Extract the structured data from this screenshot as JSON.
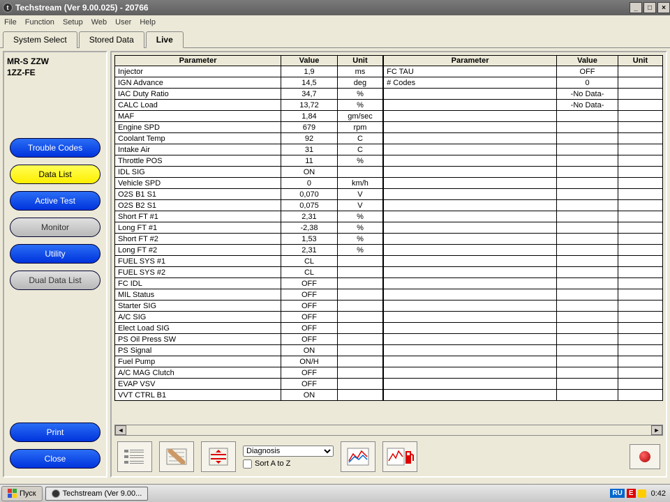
{
  "window": {
    "title": "Techstream (Ver 9.00.025) - 20766"
  },
  "menu": [
    "File",
    "Function",
    "Setup",
    "Web",
    "User",
    "Help"
  ],
  "tabs": {
    "system_select": "System Select",
    "stored_data": "Stored Data",
    "live": "Live"
  },
  "vehicle": {
    "model": "MR-S ZZW",
    "engine": "1ZZ-FE"
  },
  "side_buttons": {
    "trouble_codes": "Trouble Codes",
    "data_list": "Data List",
    "active_test": "Active Test",
    "monitor": "Monitor",
    "utility": "Utility",
    "dual_data_list": "Dual Data List",
    "print": "Print",
    "close": "Close"
  },
  "headers": {
    "parameter": "Parameter",
    "value": "Value",
    "unit": "Unit"
  },
  "left_rows": [
    {
      "p": "Injector",
      "v": "1,9",
      "u": "ms"
    },
    {
      "p": "IGN Advance",
      "v": "14,5",
      "u": "deg"
    },
    {
      "p": "IAC Duty Ratio",
      "v": "34,7",
      "u": "%"
    },
    {
      "p": "CALC Load",
      "v": "13,72",
      "u": "%"
    },
    {
      "p": "MAF",
      "v": "1,84",
      "u": "gm/sec"
    },
    {
      "p": "Engine SPD",
      "v": "679",
      "u": "rpm"
    },
    {
      "p": "Coolant Temp",
      "v": "92",
      "u": "C"
    },
    {
      "p": "Intake Air",
      "v": "31",
      "u": "C"
    },
    {
      "p": "Throttle POS",
      "v": "11",
      "u": "%"
    },
    {
      "p": "IDL SIG",
      "v": "ON",
      "u": ""
    },
    {
      "p": "Vehicle SPD",
      "v": "0",
      "u": "km/h"
    },
    {
      "p": "O2S B1 S1",
      "v": "0,070",
      "u": "V"
    },
    {
      "p": "O2S B2 S1",
      "v": "0,075",
      "u": "V"
    },
    {
      "p": "Short FT #1",
      "v": "2,31",
      "u": "%"
    },
    {
      "p": "Long FT #1",
      "v": "-2,38",
      "u": "%"
    },
    {
      "p": "Short FT #2",
      "v": "1,53",
      "u": "%"
    },
    {
      "p": "Long FT #2",
      "v": "2,31",
      "u": "%"
    },
    {
      "p": "FUEL SYS #1",
      "v": "CL",
      "u": ""
    },
    {
      "p": "FUEL SYS #2",
      "v": "CL",
      "u": ""
    },
    {
      "p": "FC IDL",
      "v": "OFF",
      "u": ""
    },
    {
      "p": "MIL Status",
      "v": "OFF",
      "u": ""
    },
    {
      "p": "Starter SIG",
      "v": "OFF",
      "u": ""
    },
    {
      "p": "A/C SIG",
      "v": "OFF",
      "u": ""
    },
    {
      "p": "Elect Load SIG",
      "v": "OFF",
      "u": ""
    },
    {
      "p": "PS Oil Press SW",
      "v": "OFF",
      "u": ""
    },
    {
      "p": "PS Signal",
      "v": "ON",
      "u": ""
    },
    {
      "p": "Fuel Pump",
      "v": "ON/H",
      "u": ""
    },
    {
      "p": "A/C MAG Clutch",
      "v": "OFF",
      "u": ""
    },
    {
      "p": "EVAP VSV",
      "v": "OFF",
      "u": ""
    },
    {
      "p": "VVT CTRL B1",
      "v": "ON",
      "u": ""
    }
  ],
  "right_rows": [
    {
      "p": "FC TAU",
      "v": "OFF",
      "u": ""
    },
    {
      "p": "# Codes",
      "v": "0",
      "u": ""
    },
    {
      "p": "",
      "v": "-No Data-",
      "u": ""
    },
    {
      "p": "",
      "v": "-No Data-",
      "u": ""
    },
    {
      "p": "",
      "v": "",
      "u": ""
    },
    {
      "p": "",
      "v": "",
      "u": ""
    },
    {
      "p": "",
      "v": "",
      "u": ""
    },
    {
      "p": "",
      "v": "",
      "u": ""
    },
    {
      "p": "",
      "v": "",
      "u": ""
    },
    {
      "p": "",
      "v": "",
      "u": ""
    },
    {
      "p": "",
      "v": "",
      "u": ""
    },
    {
      "p": "",
      "v": "",
      "u": ""
    },
    {
      "p": "",
      "v": "",
      "u": ""
    },
    {
      "p": "",
      "v": "",
      "u": ""
    },
    {
      "p": "",
      "v": "",
      "u": ""
    },
    {
      "p": "",
      "v": "",
      "u": ""
    },
    {
      "p": "",
      "v": "",
      "u": ""
    },
    {
      "p": "",
      "v": "",
      "u": ""
    },
    {
      "p": "",
      "v": "",
      "u": ""
    },
    {
      "p": "",
      "v": "",
      "u": ""
    },
    {
      "p": "",
      "v": "",
      "u": ""
    },
    {
      "p": "",
      "v": "",
      "u": ""
    },
    {
      "p": "",
      "v": "",
      "u": ""
    },
    {
      "p": "",
      "v": "",
      "u": ""
    },
    {
      "p": "",
      "v": "",
      "u": ""
    },
    {
      "p": "",
      "v": "",
      "u": ""
    },
    {
      "p": "",
      "v": "",
      "u": ""
    },
    {
      "p": "",
      "v": "",
      "u": ""
    },
    {
      "p": "",
      "v": "",
      "u": ""
    },
    {
      "p": "",
      "v": "",
      "u": ""
    }
  ],
  "toolbar": {
    "diagnosis_select": "Diagnosis",
    "sort_label": "Sort A to Z",
    "sort_checked": false
  },
  "taskbar": {
    "start": "Пуск",
    "task_app": "Techstream (Ver 9.00...",
    "lang": "RU",
    "indicator": "E",
    "time": "0:42"
  }
}
